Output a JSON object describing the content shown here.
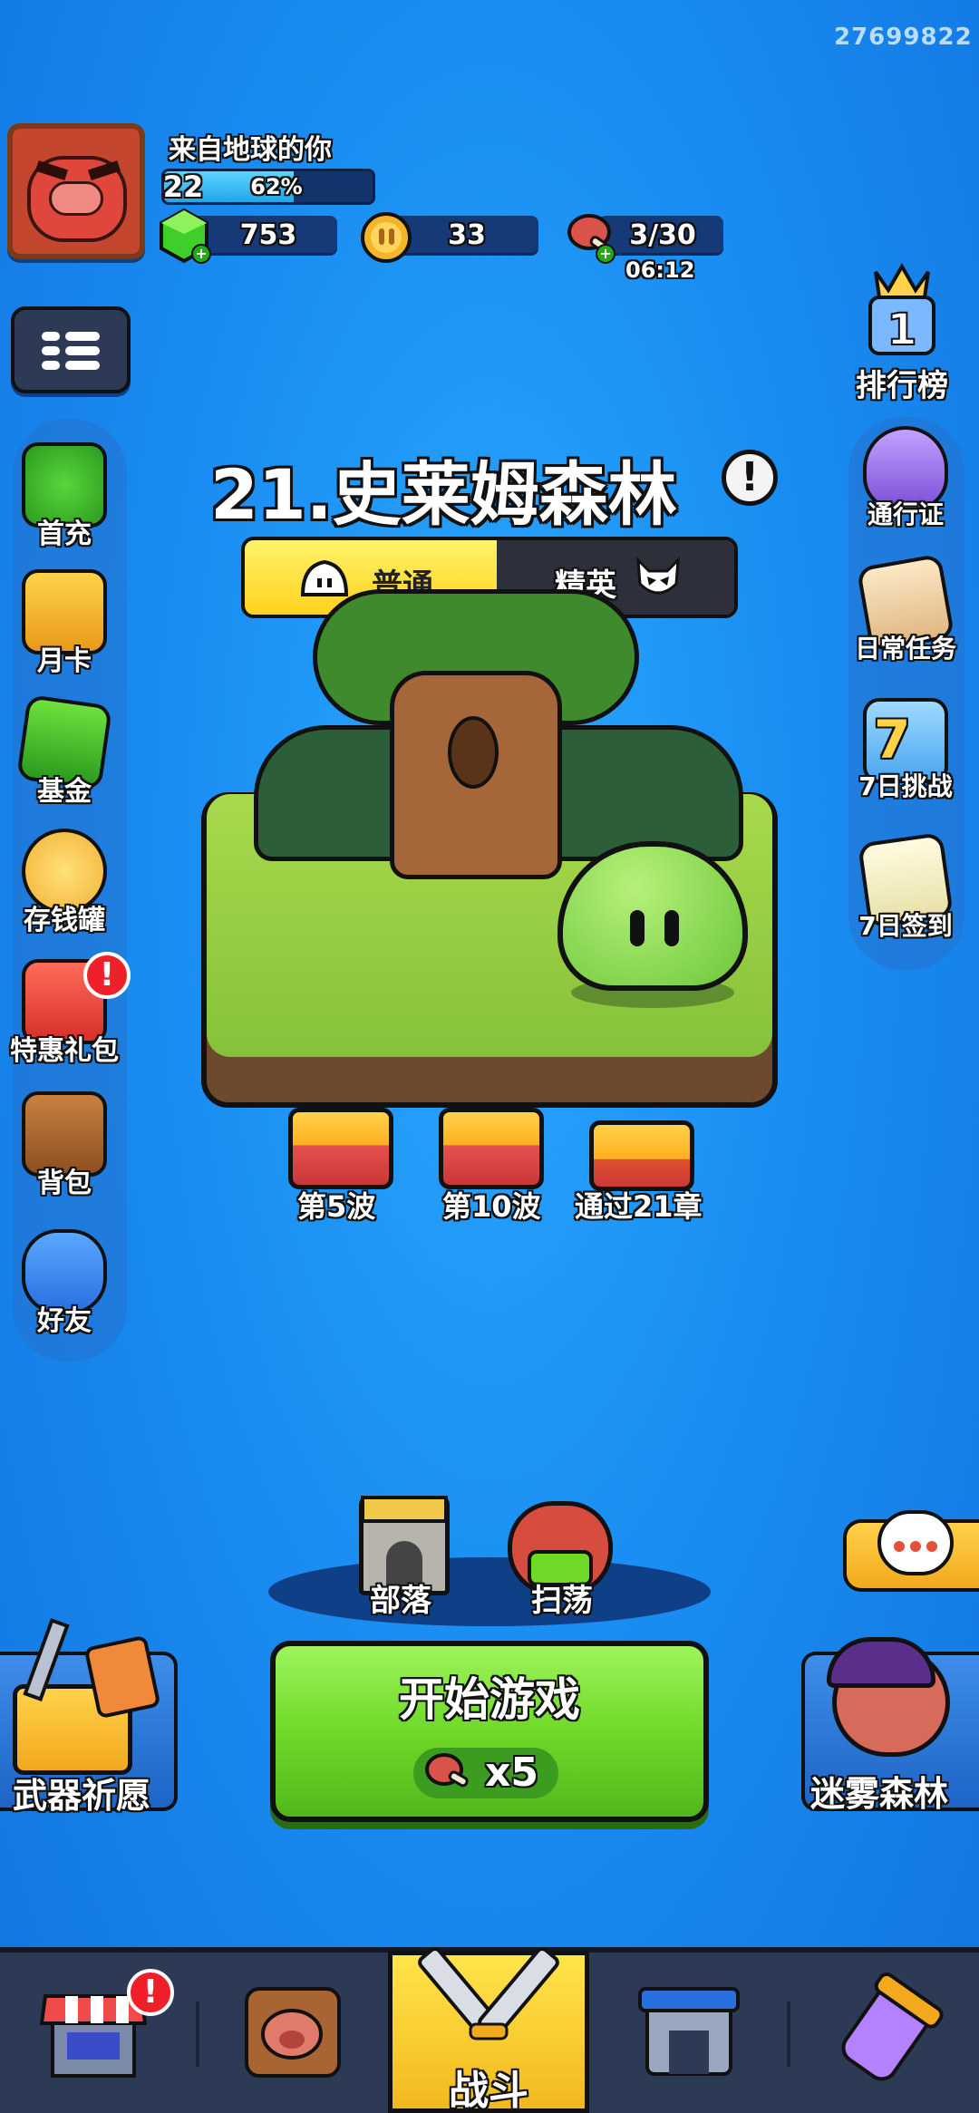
{
  "header": {
    "uid": "27699822",
    "player_name": "来自地球的你",
    "level": "22",
    "level_progress_label": "62%",
    "level_progress": 0.62
  },
  "resources": {
    "gems": "753",
    "coins": "33",
    "stamina": "3/30",
    "stamina_timer": "06:12"
  },
  "left_sidebar": {
    "items": [
      {
        "label": "首充"
      },
      {
        "label": "月卡"
      },
      {
        "label": "基金"
      },
      {
        "label": "存钱罐"
      },
      {
        "label": "特惠礼包",
        "badge": "!"
      },
      {
        "label": "背包"
      },
      {
        "label": "好友"
      }
    ]
  },
  "right_sidebar": {
    "items": [
      {
        "label": "排行榜"
      },
      {
        "label": "通行证"
      },
      {
        "label": "日常任务"
      },
      {
        "label": "7日挑战"
      },
      {
        "label": "7日签到"
      }
    ],
    "rank_number": "1",
    "challenge_number": "7"
  },
  "stage": {
    "title": "21.史莱姆森林",
    "info": "!",
    "tabs": [
      {
        "label": "普通",
        "active": true
      },
      {
        "label": "精英",
        "active": false
      }
    ],
    "rewards": [
      {
        "label": "第5波"
      },
      {
        "label": "第10波"
      },
      {
        "label": "通过21章"
      }
    ]
  },
  "actions": {
    "tribe": "部落",
    "sweep": "扫荡",
    "weapon_wish": "武器祈愿",
    "start": "开始游戏",
    "start_cost": "x5",
    "mist_forest": "迷雾森林"
  },
  "bottom_nav": {
    "battle_label": "战斗",
    "shop_badge": "!"
  },
  "colors": {
    "background": "#1a8ef2",
    "start_button": "#6fd928",
    "tab_active": "#ffd21e",
    "tab_inactive": "#2d2f3a",
    "badge": "#f0202a"
  }
}
